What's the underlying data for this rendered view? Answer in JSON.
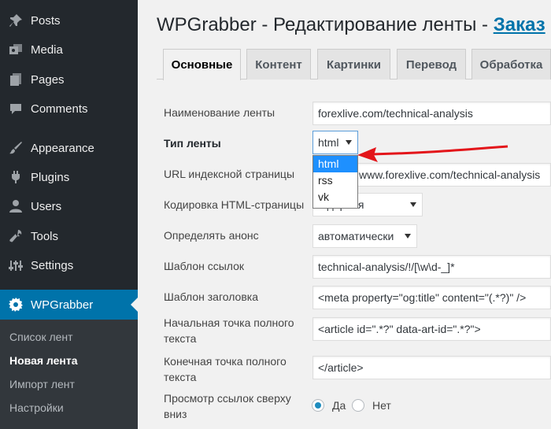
{
  "sidebar": {
    "items": [
      {
        "label": "Posts",
        "icon": "pin-icon"
      },
      {
        "label": "Media",
        "icon": "media-icon"
      },
      {
        "label": "Pages",
        "icon": "pages-icon"
      },
      {
        "label": "Comments",
        "icon": "comment-icon"
      },
      {
        "label": "Appearance",
        "icon": "brush-icon"
      },
      {
        "label": "Plugins",
        "icon": "plugin-icon"
      },
      {
        "label": "Users",
        "icon": "user-icon"
      },
      {
        "label": "Tools",
        "icon": "wrench-icon"
      },
      {
        "label": "Settings",
        "icon": "settings-icon"
      }
    ],
    "active": {
      "label": "WPGrabber",
      "icon": "gear-icon"
    },
    "submenu": [
      "Список лент",
      "Новая лента",
      "Импорт лент",
      "Настройки"
    ]
  },
  "page": {
    "title": "WPGrabber - Редактирование ленты - ",
    "title_link": "Заказ"
  },
  "tabs": [
    "Основные",
    "Контент",
    "Картинки",
    "Перевод",
    "Обработка"
  ],
  "form": {
    "feed_name_label": "Наименование ленты",
    "feed_name_value": "forexlive.com/technical-analysis",
    "feed_type_label": "Тип ленты",
    "feed_type_value": "html",
    "feed_type_options": [
      "html",
      "rss",
      "vk"
    ],
    "index_url_label": "URL индексной страницы",
    "index_url_value": "www.forexlive.com/technical-analysis",
    "encoding_label": "Кодировка HTML-страницы",
    "encoding_value": "...дарная",
    "announce_label": "Определять анонс",
    "announce_value": "автоматически",
    "link_template_label": "Шаблон ссылок",
    "link_template_value": "technical-analysis/!/[\\w\\d-_]*",
    "title_template_label": "Шаблон заголовка",
    "title_template_value": "<meta property=\"og:title\" content=\"(.*?)\" />",
    "start_point_label_1": "Начальная точка полного",
    "start_point_label_2": "текста",
    "start_point_value": "<article id=\".*?\" data-art-id=\".*?\">",
    "end_point_label_1": "Конечная точка полного",
    "end_point_label_2": "текста",
    "end_point_value": "</article>",
    "view_links_label_1": "Просмотр ссылок сверху",
    "view_links_label_2": "вниз",
    "radio_yes": "Да",
    "radio_no": "Нет"
  }
}
